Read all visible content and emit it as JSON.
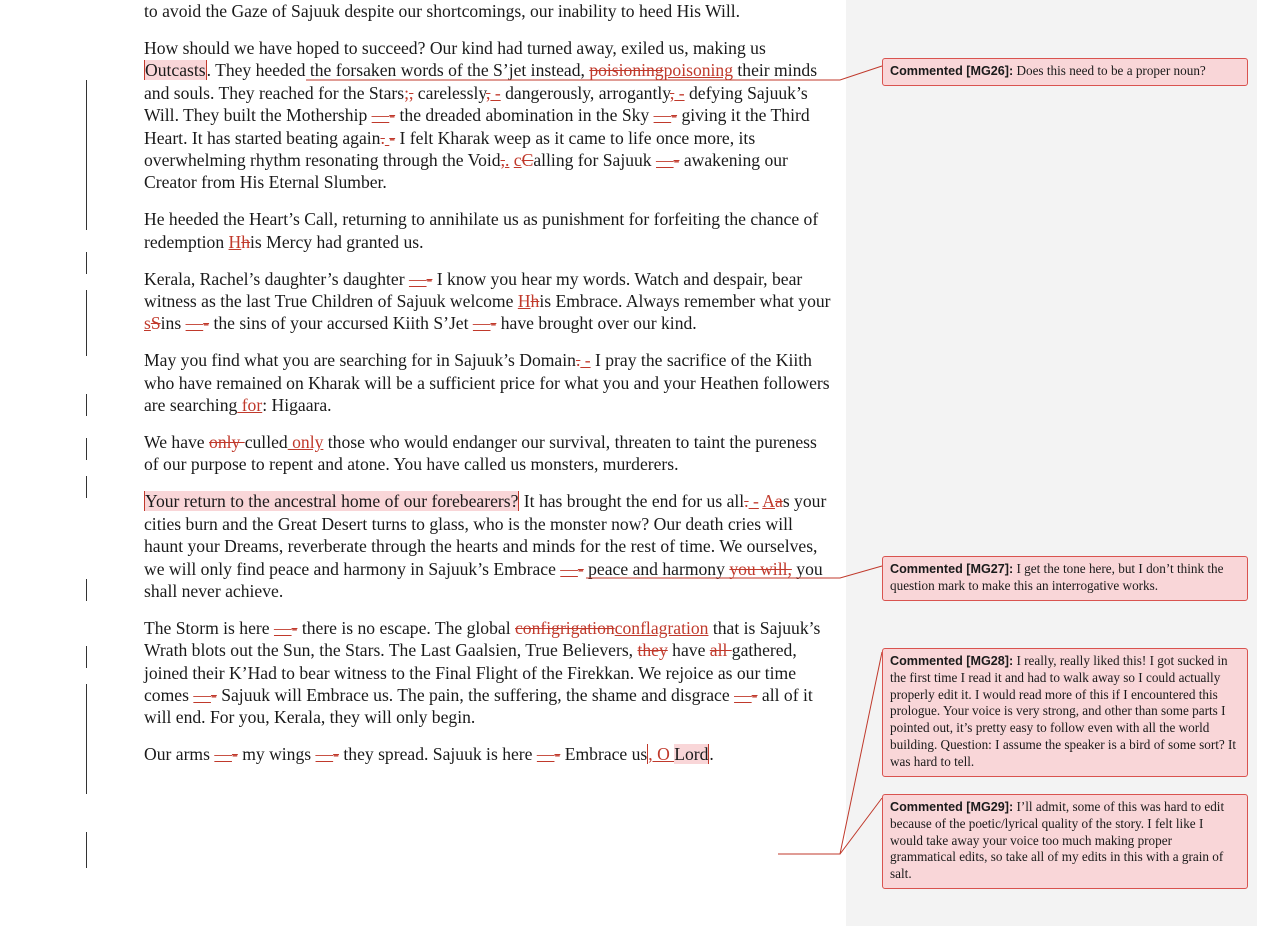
{
  "document": {
    "line0": "to avoid the Gaze of Sajuuk despite our shortcomings, our inability to heed His Will.",
    "p1": {
      "a": "How should we have hoped to succeed? Our kind had turned away, exiled us, making us ",
      "outcasts": "Outcasts",
      "b": ". They heeded the forsaken words of the S’jet instead, ",
      "del1": "poisioning",
      "ins1": "poisoning",
      "c": " their minds and souls. They reached for the Stars",
      "ins2": ";",
      "del2": ",",
      "d": " carelessly",
      "del3": ",",
      "ins3": " -",
      "e": " dangerously, arrogantly",
      "del4": ",",
      "ins4": " -",
      "f": " defying Sajuuk’s Will. They built the Mothership ",
      "dash1": "—",
      "dash1b": "-",
      "g": " the dreaded abomination in the Sky ",
      "dash2": "—",
      "dash2b": "-",
      "h": " giving it the Third Heart. It has started beating again",
      "del5": ".",
      "ins5": " ",
      "del6": " -",
      "i": " I felt Kharak weep as it came to life once more, its overwhelming rhythm resonating through the Void",
      "del7": ",",
      "ins7": ".",
      "j": " ",
      "ins8": "c",
      "del8": "C",
      "k": "alling for Sajuuk ",
      "dash3": "—",
      "dash3b": "-",
      "l": " awakening our Creator from His Eternal Slumber."
    },
    "p2": {
      "a": "He heeded the Heart’s Call, returning to annihilate us as punishment for forfeiting the chance of redemption ",
      "ins": "H",
      "del": "h",
      "b": "is Mercy had granted us."
    },
    "p3": {
      "a": "Kerala, Rachel’s daughter’s daughter ",
      "dash1": "—",
      "dash1b": "-",
      "b": " I know you hear my words. Watch and despair, bear witness as the last True Children of Sajuuk welcome ",
      "ins1": "H",
      "del1": "h",
      "c": "is Embrace. Always remember what your ",
      "ins2": "s",
      "del2": "S",
      "d": "ins ",
      "dash2": "—",
      "dash2b": "-",
      "e": " the sins of your accursed Kiith S’Jet ",
      "dash3": "—",
      "dash3b": "-",
      "f": " have brought over our kind."
    },
    "p4": {
      "a": "May you find what you are searching for in Sajuuk’s Domain",
      "del": ".",
      "ins": " -",
      "b": " I pray the sacrifice of the Kiith who have remained on Kharak will be a sufficient price for what you and your Heathen followers are searching",
      "ins2": " for",
      "c": ": Higaara."
    },
    "p5": {
      "a": "We have ",
      "del": "only ",
      "b": "culled",
      "ins": " only",
      "c": " those who would endanger our survival, threaten to taint the pureness of our purpose to repent and atone. You have called us monsters, murderers."
    },
    "p6": {
      "hl": "Your return to the ancestral home of our forebearers?",
      "a": " It has brought the end for us all",
      "del1": ".",
      "ins1": " -",
      "b": " ",
      "ins2": "A",
      "del2": "a",
      "c": "s your cities burn and the Great Desert turns to glass, who is the monster now? Our death cries will haunt your Dreams, reverberate through the hearts and minds for the rest of time. We ourselves, we will only find peace and harmony in Sajuuk’s Embrace ",
      "dash1": "—",
      "dash1b": "-",
      "d": " peace and harmony ",
      "del3": "you will,",
      "e": " you shall never achieve."
    },
    "p7": {
      "a": "The Storm is here ",
      "dash1": "—",
      "dash1b": "-",
      "b": " there is no escape. The global ",
      "del1": "configrigation",
      "ins1": "conflagration",
      "c": " that is Sajuuk’s Wrath blots out the Sun, the Stars. The Last Gaalsien, True Believers, ",
      "del2": "they",
      "d": " have ",
      "del3": "all ",
      "e": "gathered, joined their K’Had to bear witness to the Final Flight of the Firekkan. We rejoice as our time comes ",
      "dash2": "—",
      "dash2b": "-",
      "f": " Sajuuk will Embrace us. The pain, the suffering, the shame and disgrace ",
      "dash3": "—",
      "dash3b": "-",
      "g": " all of it will end. For you, Kerala, they will only begin."
    },
    "p8": {
      "a": "Our arms ",
      "dash1": "—",
      "dash1b": "-",
      "b": " my wings ",
      "dash2": "—",
      "dash2b": "-",
      "c": " they spread. Sajuuk is here ",
      "dash3": "—",
      "dash3b": "-",
      "d": " Embrace us",
      "ins1": ", O ",
      "hl": "Lord",
      "e": "."
    }
  },
  "comments": [
    {
      "ref": "Commented [MG26]:",
      "text": " Does this need to be a proper noun?"
    },
    {
      "ref": "Commented [MG27]:",
      "text": " I get the tone here, but I don’t think the question mark to make this an interrogative works."
    },
    {
      "ref": "Commented [MG28]:",
      "text": " I really, really liked this! I got sucked in the first time I read it and had to walk away so I could actually properly edit it. I would read more of this if I encountered this prologue. Your voice is very strong, and other than some parts I pointed out, it’s pretty easy to follow even with all the world building. Question: I assume the speaker is a bird of some sort? It was hard to tell."
    },
    {
      "ref": "Commented [MG29]:",
      "text": " I’ll admit, some of this was hard to edit because of the poetic/lyrical quality of the story. I felt like I would take away your voice too much making proper grammatical edits, so take all of my edits in this with a grain of salt."
    }
  ],
  "colors": {
    "revision": "#c0392b",
    "comment_fill": "#f9d6d8",
    "comment_border": "#d9534f",
    "margin_pane": "#f3f3f3"
  }
}
